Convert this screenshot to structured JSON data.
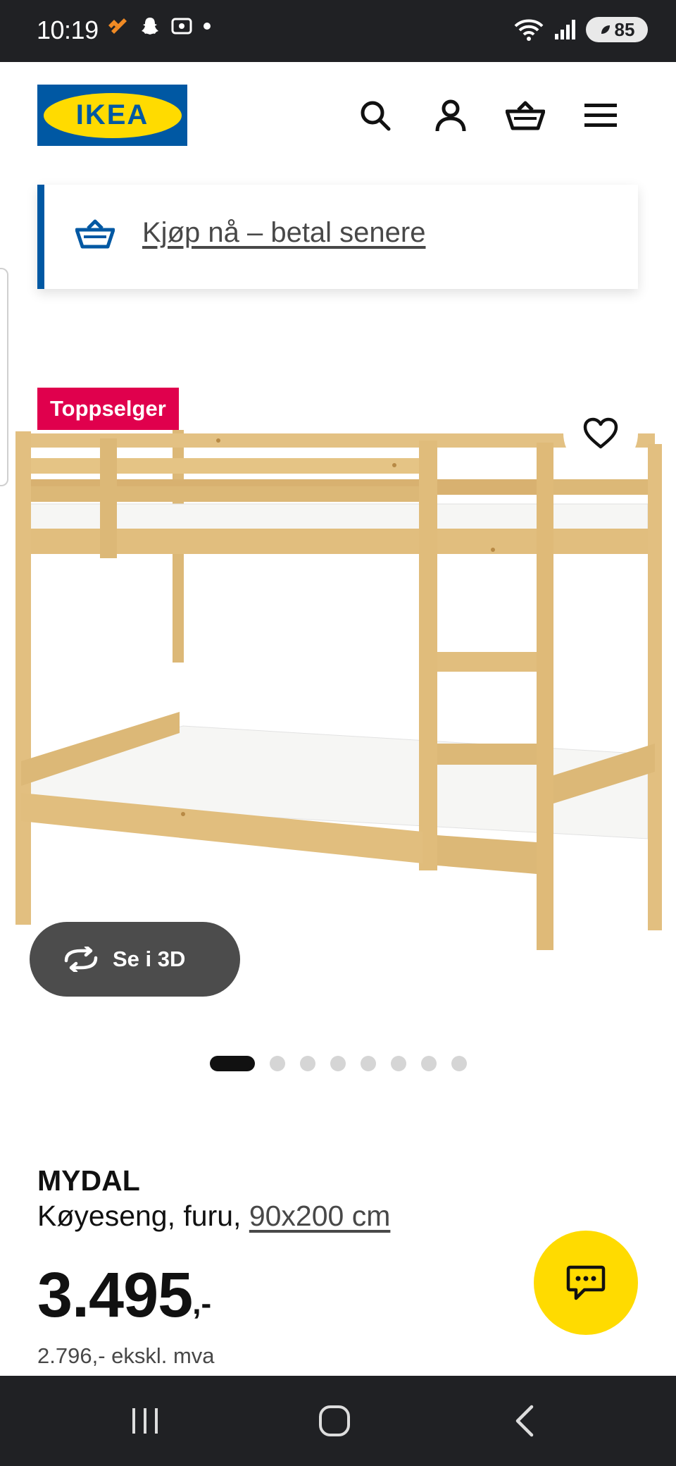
{
  "status_bar": {
    "time": "10:19",
    "battery": "85"
  },
  "header": {
    "logo_text": "IKEA",
    "icons": [
      "search-icon",
      "account-icon",
      "basket-icon",
      "menu-icon"
    ]
  },
  "banner": {
    "link_text": "Kjøp nå – betal senere",
    "icon": "basket-icon"
  },
  "product_media": {
    "badge": "Toppselger",
    "view_3d_label": "Se i 3D",
    "carousel": {
      "total": 8,
      "active_index": 0
    }
  },
  "product": {
    "name": "MYDAL",
    "description_prefix": "Køyeseng, furu, ",
    "size_link": "90x200 cm",
    "price_main": "3.495",
    "price_suffix": ",-",
    "price_ex_vat": "2.796,- ekskl. mva"
  },
  "colors": {
    "ikea_blue": "#0058a3",
    "ikea_yellow": "#ffdb00",
    "badge_red": "#e0004d",
    "status_bar_bg": "#202124"
  }
}
